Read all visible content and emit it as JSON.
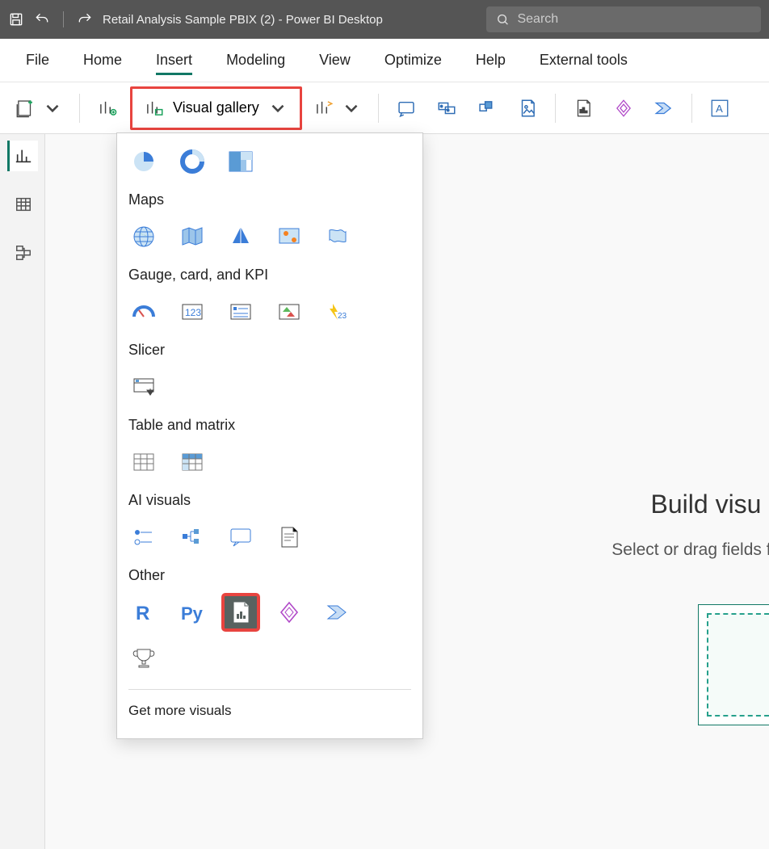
{
  "titlebar": {
    "title": "Retail Analysis Sample PBIX (2) - Power BI Desktop",
    "search_placeholder": "Search"
  },
  "menu": {
    "items": [
      "File",
      "Home",
      "Insert",
      "Modeling",
      "View",
      "Optimize",
      "Help",
      "External tools"
    ],
    "active": "Insert"
  },
  "toolbar": {
    "visual_gallery_label": "Visual gallery"
  },
  "gallery": {
    "categories": [
      {
        "title": "",
        "icons": [
          "pie",
          "donut",
          "treemap"
        ]
      },
      {
        "title": "Maps",
        "icons": [
          "globe",
          "filledmap",
          "azuremap",
          "arcgis",
          "shapemap"
        ]
      },
      {
        "title": "Gauge, card, and KPI",
        "icons": [
          "gauge",
          "card",
          "multicard",
          "kpi",
          "kpicard"
        ]
      },
      {
        "title": "Slicer",
        "icons": [
          "slicer"
        ]
      },
      {
        "title": "Table and matrix",
        "icons": [
          "table",
          "matrix"
        ]
      },
      {
        "title": "AI visuals",
        "icons": [
          "keyinfluencers",
          "decomptree",
          "qna",
          "narrative"
        ]
      },
      {
        "title": "Other",
        "icons": [
          "rscript",
          "python",
          "paginated",
          "powerapps",
          "powerautomate",
          "trophy"
        ]
      }
    ],
    "more_label": "Get more visuals"
  },
  "canvas": {
    "heading": "Build visu",
    "subtext": "Select or drag fields from"
  }
}
